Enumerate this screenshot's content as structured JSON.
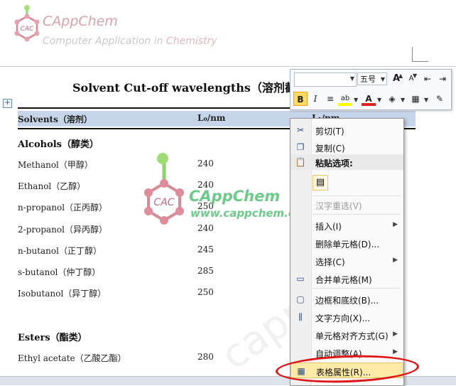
{
  "header": {
    "logo_text": "CAC",
    "brand": "CAppChem",
    "subtitle_prefix": "Computer Application in ",
    "subtitle_suffix": "Chemistry"
  },
  "document": {
    "title": "Solvent Cut-off wavelengths（溶剂截",
    "columns": [
      "Solvents（溶剂）",
      "L₀/nm",
      "L₁/nm"
    ],
    "sections": [
      {
        "category": "Alcohols（醇类）",
        "rows": [
          {
            "name": "Methanol（甲醇）",
            "value": "240"
          },
          {
            "name": "Ethanol（乙醇）",
            "value": "240"
          },
          {
            "name": "n-propanol（正丙醇）",
            "value": "250"
          },
          {
            "name": "2-propanol（异丙醇）",
            "value": "240"
          },
          {
            "name": "n-butanol（正丁醇）",
            "value": "245"
          },
          {
            "name": "s-butanol（仲丁醇）",
            "value": "285"
          },
          {
            "name": "Isobutanol（异丁醇）",
            "value": "250"
          }
        ]
      },
      {
        "category": "Esters（酯类）",
        "rows": [
          {
            "name": "Ethyl acetate（乙酸乙酯）",
            "value": "280"
          }
        ]
      }
    ]
  },
  "watermark": {
    "logo_text": "CAC",
    "name": "CAppChem",
    "url": "www.cappchem.com",
    "diagonal": "cappchem"
  },
  "mini_toolbar": {
    "font_name": "",
    "font_size": "五号",
    "grow_label": "A",
    "shrink_label": "A",
    "bold_label": "B",
    "italic_label": "I",
    "font_color_label": "A"
  },
  "context_menu": {
    "items": [
      {
        "label": "剪切(T)",
        "icon": "scissors-icon",
        "enabled": true
      },
      {
        "label": "复制(C)",
        "icon": "copy-icon",
        "enabled": true
      },
      {
        "label": "粘贴选项:",
        "icon": "paste-icon",
        "enabled": true
      },
      {
        "label": "汉字重选(V)",
        "enabled": false
      },
      {
        "label": "插入(I)",
        "submenu": true,
        "enabled": true
      },
      {
        "label": "删除单元格(D)...",
        "enabled": true
      },
      {
        "label": "选择(C)",
        "submenu": true,
        "enabled": true
      },
      {
        "label": "合并单元格(M)",
        "icon": "merge-cells-icon",
        "enabled": true
      },
      {
        "label": "边框和底纹(B)...",
        "icon": "borders-icon",
        "enabled": true
      },
      {
        "label": "文字方向(X)...",
        "icon": "text-direction-icon",
        "enabled": true
      },
      {
        "label": "单元格对齐方式(G)",
        "submenu": true,
        "enabled": true
      },
      {
        "label": "自动调整(A)",
        "submenu": true,
        "enabled": true
      },
      {
        "label": "表格属性(R)...",
        "icon": "table-properties-icon",
        "enabled": true,
        "highlighted": true
      }
    ]
  },
  "colors": {
    "accent_highlight": "#ffeaa8",
    "annotation_red": "#e01515",
    "watermark_green": "#5bc77d",
    "table_header_bg": "#c6d5ea"
  }
}
